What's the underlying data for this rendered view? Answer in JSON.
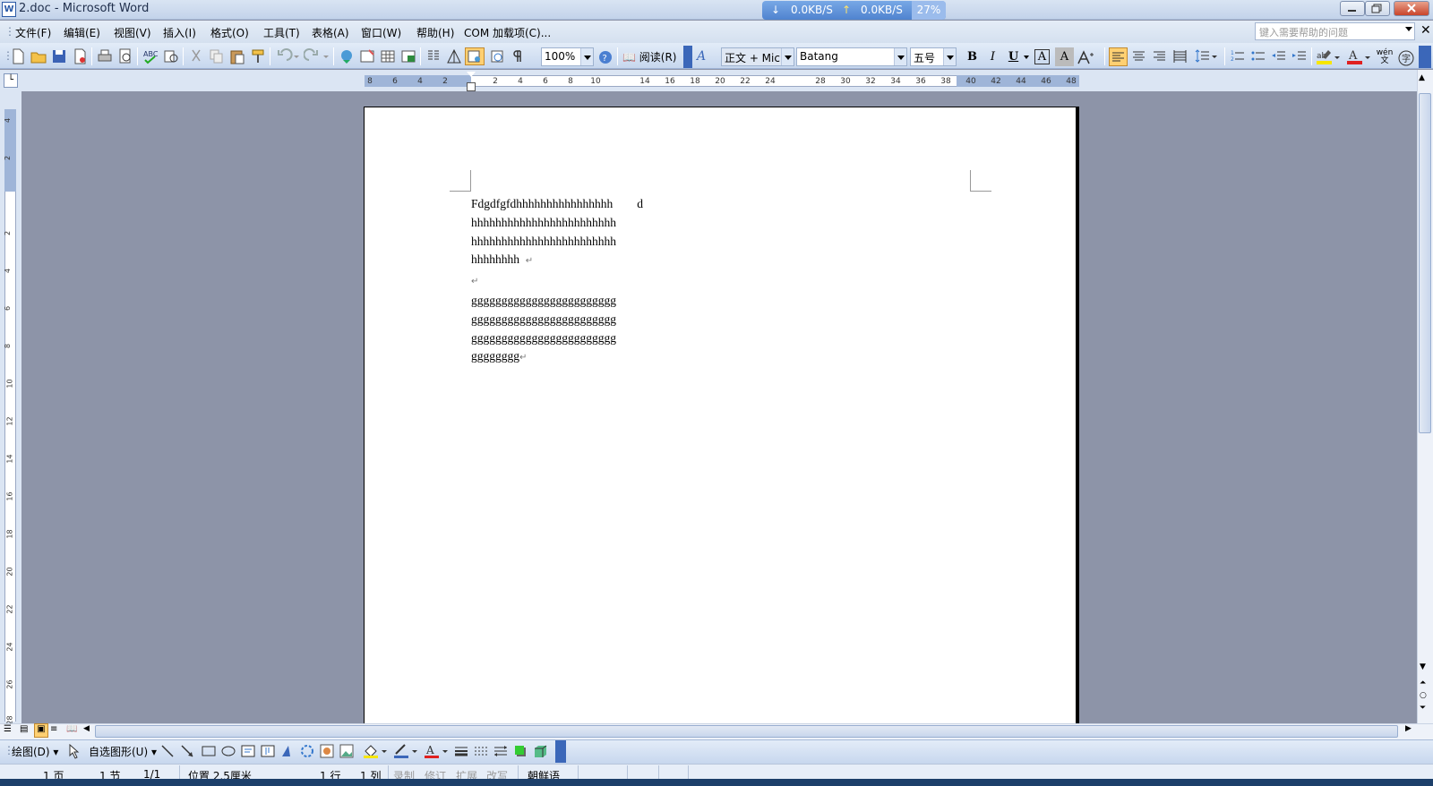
{
  "window": {
    "title": "2.doc - Microsoft Word",
    "app_icon_glyph": "W"
  },
  "netmon": {
    "down": "0.0KB/S",
    "up": "0.0KB/S",
    "percent": "27%"
  },
  "menu": {
    "items": [
      "文件(F)",
      "编辑(E)",
      "视图(V)",
      "插入(I)",
      "格式(O)",
      "工具(T)",
      "表格(A)",
      "窗口(W)",
      "帮助(H)",
      "COM 加载项(C)..."
    ],
    "help_placeholder": "键入需要帮助的问题"
  },
  "toolbar": {
    "zoom": "100%",
    "read_label": "阅读(R)",
    "style": "正文 + Mic",
    "font": "Batang",
    "size": "五号",
    "bold": "B",
    "italic": "I",
    "underline": "U",
    "char_border": "A",
    "char_shading": "A",
    "wen": "wén"
  },
  "ruler": {
    "h_ticks": [
      "8",
      "6",
      "4",
      "2",
      "2",
      "4",
      "6",
      "8",
      "10",
      "14",
      "16",
      "18",
      "20",
      "22",
      "24",
      "28",
      "30",
      "32",
      "34",
      "36",
      "38",
      "40",
      "42",
      "44",
      "46",
      "48"
    ],
    "v_ticks": [
      "4",
      "2",
      "2",
      "4",
      "6",
      "8",
      "10",
      "12",
      "14",
      "16",
      "18",
      "20",
      "22",
      "24",
      "26",
      "28"
    ]
  },
  "document": {
    "paragraphs": [
      {
        "lines": [
          "Fdgdfgfdhhhhhhhhhhhhhhhh        d  ",
          "hhhhhhhhhhhhhhhhhhhhhhhh",
          "hhhhhhhhhhhhhhhhhhhhhhhh",
          "hhhhhhhh  "
        ]
      },
      {
        "lines": [
          ""
        ]
      },
      {
        "lines": [
          "gggggggggggggggggggggggg",
          "gggggggggggggggggggggggg",
          "gggggggggggggggggggggggg",
          "gggggggg"
        ]
      }
    ],
    "paragraph_mark": "↵"
  },
  "drawbar": {
    "draw_label": "绘图(D)",
    "autoshape_label": "自选图形(U)"
  },
  "status": {
    "page": "1 页",
    "section": "1 节",
    "pages": "1/1",
    "position": "位置 2.5厘米",
    "line": "1 行",
    "column": "1 列",
    "rec": "录制",
    "trk": "修订",
    "ext": "扩展",
    "ovr": "改写",
    "language": "朝鲜语"
  },
  "colors": {
    "accent": "#4f83cf",
    "highlight": "#ffd072",
    "font_color_bar": "#e02020",
    "highlight_bar": "#f7e600"
  }
}
